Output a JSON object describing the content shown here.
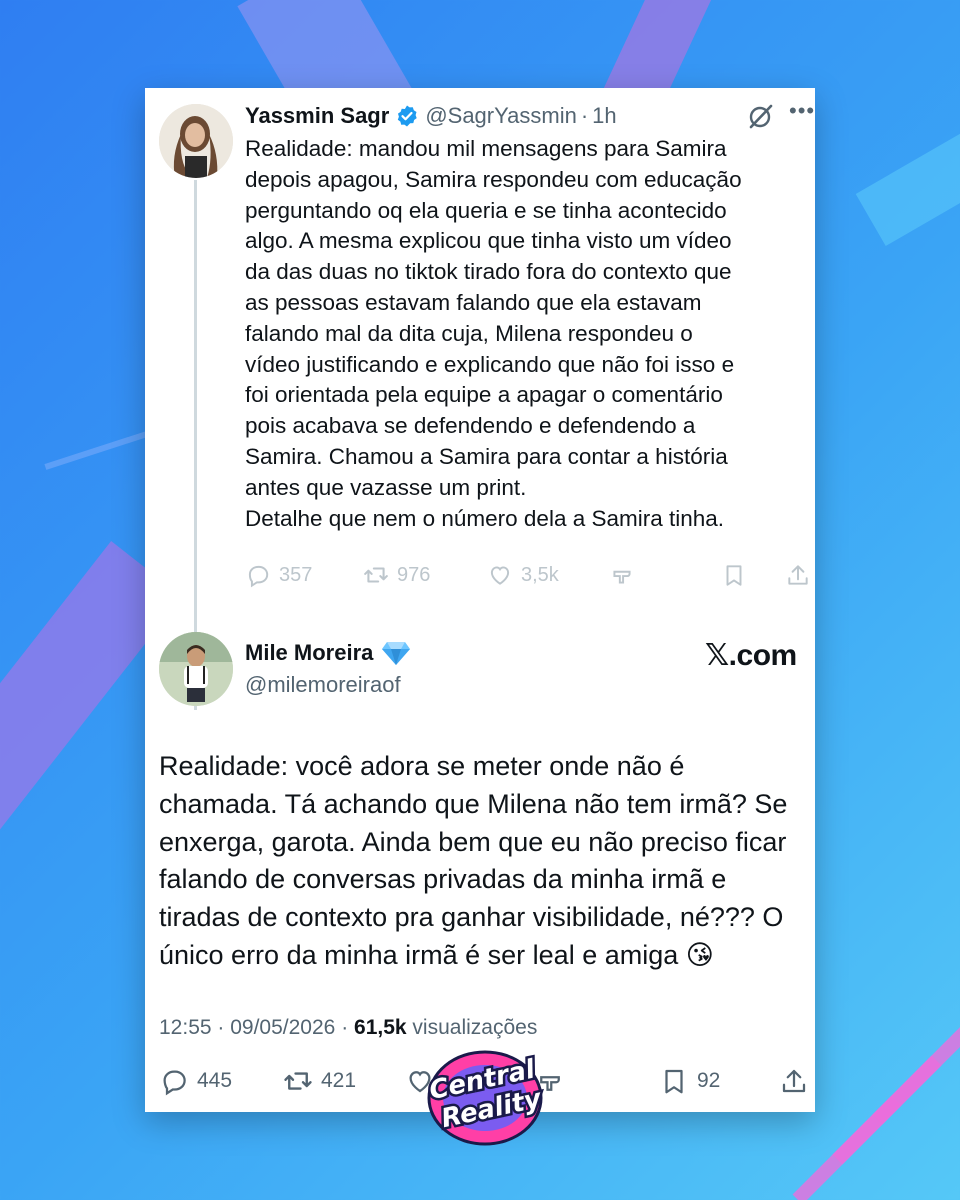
{
  "tweet1": {
    "author_name": "Yassmin Sagr",
    "handle": "@SagrYassmin",
    "time": "1h",
    "icons": [
      "verified-badge-icon",
      "grok-icon",
      "more-icon"
    ],
    "body_lines": [
      "Realidade: mandou mil mensagens para Samira",
      "depois apagou, Samira respondeu com educação",
      "perguntando oq ela queria e se tinha acontecido",
      "algo. A mesma explicou que tinha visto um vídeo",
      "da das duas no tiktok tirado fora do contexto que",
      "as pessoas estavam falando que ela estavam",
      "falando mal da dita cuja, Milena respondeu o",
      "vídeo justificando e explicando que não foi isso e",
      "foi orientada pela equipe a apagar o comentário",
      "pois acabava se defendendo e defendendo a",
      "Samira. Chamou a Samira para contar a história",
      "antes que vazasse um print.",
      "Detalhe que nem o número dela a Samira tinha."
    ],
    "actions": {
      "replies": "357",
      "reposts": "976",
      "likes": "3,5k"
    }
  },
  "tweet2": {
    "author_name": "Mile Moreira",
    "badge_icon": "gem-icon",
    "handle": "@milemoreiraof",
    "site_label": "𝕏.com",
    "body_lines": [
      "Realidade: você adora se meter onde não é",
      "chamada. Tá achando que Milena não tem irmã? Se",
      "enxerga, garota. Ainda bem que eu não preciso ficar",
      "falando de conversas privadas da minha irmã e",
      "tiradas de contexto pra ganhar visibilidade, né??? O",
      "único erro da minha irmã é ser leal e amiga 😘"
    ],
    "meta": {
      "time": "12:55",
      "date": "09/05/2026",
      "views_count": "61,5k",
      "views_label": "visualizações"
    },
    "actions": {
      "replies": "445",
      "reposts": "421",
      "bookmarks": "92"
    }
  },
  "watermark": {
    "line1": "Central",
    "line2": "Reality"
  },
  "colors": {
    "background_start": "#2f7ef2",
    "background_end": "#55c8f7",
    "verified": "#1d9bf0",
    "muted_text": "#536471",
    "logo_pink": "#ff3fa6"
  }
}
